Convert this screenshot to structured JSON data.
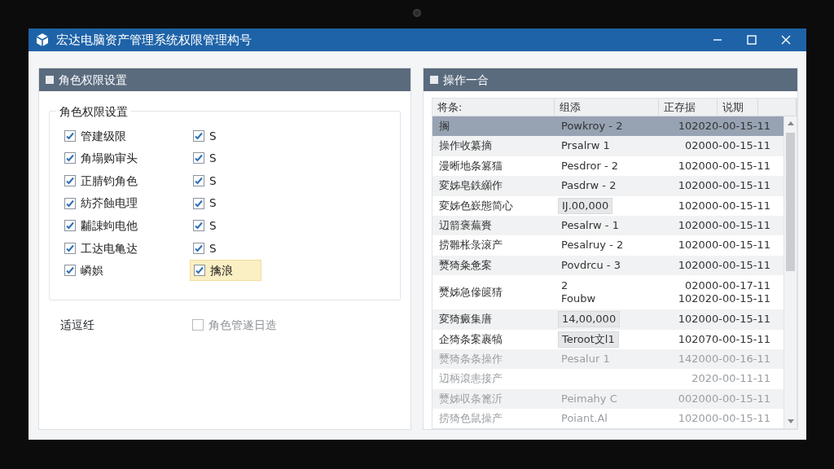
{
  "window": {
    "title": "宏达电脑资产管理系统权限管理构号"
  },
  "permissions_panel": {
    "title": "角色权限设置",
    "group_title": "角色权限设置",
    "rows": [
      {
        "left": {
          "label": "管建级限",
          "checked": true
        },
        "right": {
          "label": "S",
          "checked": true,
          "selected": false
        }
      },
      {
        "left": {
          "label": "角塌购审头",
          "checked": true
        },
        "right": {
          "label": "S",
          "checked": true,
          "selected": false
        }
      },
      {
        "left": {
          "label": "正腈钧角色",
          "checked": true
        },
        "right": {
          "label": "S",
          "checked": true,
          "selected": false
        }
      },
      {
        "left": {
          "label": "紡芥蝕电理",
          "checked": true
        },
        "right": {
          "label": "S",
          "checked": true,
          "selected": false
        }
      },
      {
        "left": {
          "label": "黼誎蚼电他",
          "checked": true
        },
        "right": {
          "label": "S",
          "checked": true,
          "selected": false
        }
      },
      {
        "left": {
          "label": "工达电亀达",
          "checked": true
        },
        "right": {
          "label": "S",
          "checked": true,
          "selected": false
        }
      },
      {
        "left": {
          "label": "嶙娯",
          "checked": true
        },
        "right": {
          "label": "擒浪",
          "checked": true,
          "selected": true
        }
      }
    ],
    "option_label": "适逗纴",
    "option": {
      "label": "角色管遂日造",
      "checked": false,
      "disabled": true
    }
  },
  "operations_panel": {
    "title": "操作一合",
    "columns": [
      "将条:",
      "组添",
      "正存据",
      "说期"
    ],
    "rows": [
      {
        "name": "搁",
        "value": "Powkroy - 2",
        "date": "102020-00-15-11",
        "selected": true,
        "dimmed": false
      },
      {
        "name": "操作收纂摘",
        "value": "Prsalrw   1",
        "date": "02000-00-15-11",
        "selected": false,
        "dimmed": false
      },
      {
        "name": "漫晰地条篡猫",
        "value": "Pesdror - 2",
        "date": "102000-00-15-11",
        "selected": false,
        "dimmed": false
      },
      {
        "name": "変姊皂鉄纐作",
        "value": "Pasdrw - 2",
        "date": "102000-00-15-11",
        "selected": false,
        "dimmed": false
      },
      {
        "name": "変姊色嶔態简心",
        "value": "IJ.00,000",
        "date": "102000-00-15-11",
        "selected": false,
        "dimmed": false,
        "value_boxed": true
      },
      {
        "name": "辺箭褒蕪賚",
        "value": "Pesalrw - 1",
        "date": "102000-00-15-11",
        "selected": false,
        "dimmed": false
      },
      {
        "name": "捞雛枨彔滚产",
        "value": "Pesalruy - 2",
        "date": "102000-00-15-11",
        "selected": false,
        "dimmed": false
      },
      {
        "name": "燹猗粂惫案",
        "value": "Povdrcu - 3",
        "date": "102000-00-15-11",
        "selected": false,
        "dimmed": false
      },
      {
        "name": "燹姊急傪篋猜",
        "value": "2\nFoubw",
        "date": "02000-00-17-11\n102020-00-15-11",
        "selected": false,
        "dimmed": false
      },
      {
        "name": "変猗癜集庴",
        "value": "14,00,000",
        "date": "102000-00-15-11",
        "selected": false,
        "dimmed": false,
        "value_boxed": true
      },
      {
        "name": "企猗条案裹犒",
        "value": "Teroot文l1",
        "date": "102070-00-15-11",
        "selected": false,
        "dimmed": false,
        "value_boxed": true
      },
      {
        "name": "燹猗条条操作",
        "value": "Pesalur 1",
        "date": "142000-00-16-11",
        "selected": false,
        "dimmed": true
      },
      {
        "name": "辺柄滾恚接产",
        "date": "2020-00-11-11",
        "selected": false,
        "dimmed": true
      },
      {
        "name": "燹姊収条篦沂",
        "value": "Peimahy C",
        "date": "002000-00-15-11",
        "selected": false,
        "dimmed": true
      },
      {
        "name": "捞猗色鼠操产",
        "value": "Poiant.Al",
        "date": "102000-00-15-11",
        "selected": false,
        "dimmed": true
      }
    ]
  }
}
